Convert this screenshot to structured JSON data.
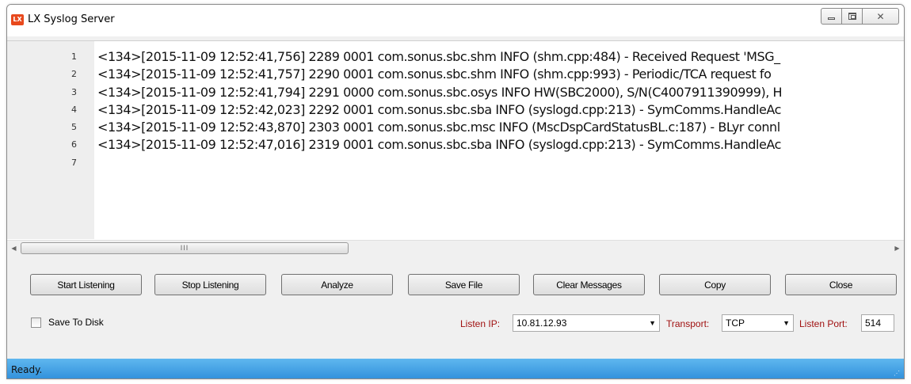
{
  "window": {
    "title": "LX Syslog Server",
    "app_icon_text": "LX"
  },
  "editor": {
    "line_numbers": [
      "1",
      "2",
      "3",
      "4",
      "5",
      "6",
      "7"
    ],
    "lines": [
      "<134>[2015-11-09 12:52:41,756] 2289 0001 com.sonus.sbc.shm INFO (shm.cpp:484) - Received Request 'MSG_",
      "<134>[2015-11-09 12:52:41,757] 2290 0001 com.sonus.sbc.shm INFO (shm.cpp:993) - Periodic/TCA request fo",
      "<134>[2015-11-09 12:52:41,794] 2291 0000 com.sonus.sbc.osys INFO HW(SBC2000), S/N(C4007911390999), H",
      "<134>[2015-11-09 12:52:42,023] 2292 0001 com.sonus.sbc.sba INFO (syslogd.cpp:213) - SymComms.HandleAc",
      "<134>[2015-11-09 12:52:43,870] 2303 0001 com.sonus.sbc.msc INFO (MscDspCardStatusBL.c:187) - BLyr connl",
      "<134>[2015-11-09 12:52:47,016] 2319 0001 com.sonus.sbc.sba INFO (syslogd.cpp:213) - SymComms.HandleAc",
      ""
    ],
    "scroll_thumb_grip": "III"
  },
  "buttons": {
    "start": "Start Listening",
    "stop": "Stop Listening",
    "analyze": "Analyze",
    "save_file": "Save File",
    "clear": "Clear Messages",
    "copy": "Copy",
    "close": "Close"
  },
  "options": {
    "save_to_disk_label": "Save To Disk",
    "save_to_disk_checked": false,
    "listen_ip_label": "Listen IP:",
    "listen_ip_value": "10.81.12.93",
    "transport_label": "Transport:",
    "transport_value": "TCP",
    "listen_port_label": "Listen Port:",
    "listen_port_value": "514"
  },
  "status": {
    "text": "Ready."
  },
  "colors": {
    "label_red": "#a01010",
    "status_blue": "#2f8fdb",
    "app_icon": "#e8491d"
  }
}
